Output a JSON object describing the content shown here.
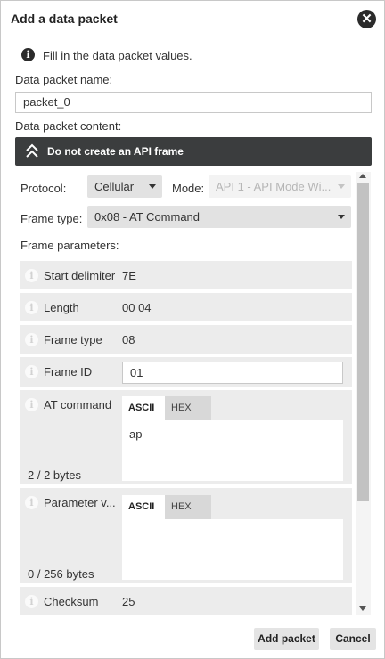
{
  "dialog": {
    "title": "Add a data packet",
    "close_symbol": "✕"
  },
  "info": {
    "icon_glyph": "i",
    "text": "Fill in the data packet values."
  },
  "packet_name": {
    "label": "Data packet name:",
    "value": "packet_0"
  },
  "packet_content": {
    "label": "Data packet content:",
    "api_toggle_label": "Do not create an API frame"
  },
  "protocol": {
    "label": "Protocol:",
    "selected": "Cellular"
  },
  "mode": {
    "label": "Mode:",
    "selected": "API 1 - API Mode Wi..."
  },
  "frame_type_select": {
    "label": "Frame type:",
    "selected": "0x08 - AT Command"
  },
  "frame_parameters": {
    "label": "Frame parameters:",
    "icon_glyph": "i",
    "start_delimiter": {
      "label": "Start delimiter",
      "value": "7E"
    },
    "length": {
      "label": "Length",
      "value": "00 04"
    },
    "frame_type": {
      "label": "Frame type",
      "value": "08"
    },
    "frame_id": {
      "label": "Frame ID",
      "value": "01"
    },
    "at_command": {
      "label": "AT command",
      "tab_ascii": "ASCII",
      "tab_hex": "HEX",
      "value": "ap",
      "bytes": "2 / 2 bytes"
    },
    "parameter_value": {
      "label": "Parameter v...",
      "tab_ascii": "ASCII",
      "tab_hex": "HEX",
      "value": "",
      "bytes": "0 / 256 bytes"
    },
    "checksum": {
      "label": "Checksum",
      "value": "25"
    }
  },
  "footer": {
    "add_label": "Add packet",
    "cancel_label": "Cancel"
  },
  "colors": {
    "api_bar": "#3b3d3e",
    "row_background": "#ececec",
    "select_background": "#e2e2e2"
  }
}
